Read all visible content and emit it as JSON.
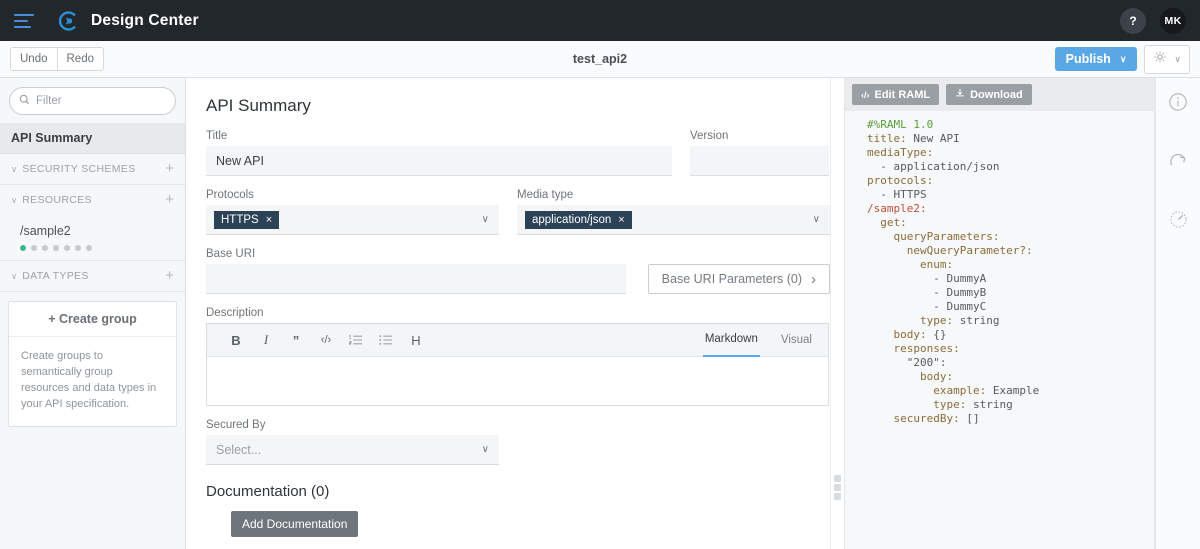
{
  "topbar": {
    "menu_icon": "hamburger-icon",
    "logo_icon": "mulesoft-logo-icon",
    "app_title": "Design Center",
    "help_label": "?",
    "avatar_initials": "MK"
  },
  "subbar": {
    "undo_label": "Undo",
    "redo_label": "Redo",
    "document_title": "test_api2",
    "publish_label": "Publish",
    "publish_color": "#5aa7e6",
    "publish_caret": "∨",
    "settings_icon": "gear-icon",
    "settings_caret": "∨"
  },
  "sidebar": {
    "filter_placeholder": "Filter",
    "filter_value": "",
    "search_icon": "search-icon",
    "active_item": "API Summary",
    "sections": [
      {
        "label": "SECURITY SCHEMES",
        "caret": "∨",
        "add": "+"
      },
      {
        "label": "RESOURCES",
        "caret": "∨",
        "add": "+"
      },
      {
        "label": "DATA TYPES",
        "caret": "∨",
        "add": "+"
      }
    ],
    "resource": {
      "name": "/sample2",
      "dots_total": 7,
      "dots_active": 1,
      "active_color": "#3fb58b",
      "inactive_color": "#c6cbcf"
    },
    "create_group": {
      "button_label": "+  Create group",
      "description": "Create groups to semantically group resources and data types in your API specification."
    }
  },
  "main": {
    "heading": "API Summary",
    "title": {
      "label": "Title",
      "value": "New API"
    },
    "version": {
      "label": "Version",
      "value": ""
    },
    "protocols": {
      "label": "Protocols",
      "chips": [
        "HTTPS"
      ],
      "caret": "∨"
    },
    "media_type": {
      "label": "Media type",
      "chips": [
        "application/json"
      ],
      "caret": "∨"
    },
    "base_uri": {
      "label": "Base URI",
      "value": "",
      "params_label": "Base URI Parameters (0)",
      "params_caret": "›"
    },
    "description": {
      "label": "Description",
      "value": "",
      "toolbar": [
        {
          "name": "bold-icon",
          "glyph": "B"
        },
        {
          "name": "italic-icon",
          "glyph": "I"
        },
        {
          "name": "quote-icon",
          "glyph": "”"
        },
        {
          "name": "code-icon",
          "glyph": "‹/›"
        },
        {
          "name": "ordered-list-icon",
          "glyph": "☰"
        },
        {
          "name": "bullet-list-icon",
          "glyph": "☰"
        },
        {
          "name": "heading-icon",
          "glyph": "H"
        }
      ],
      "tabs": [
        {
          "label": "Markdown",
          "active": true
        },
        {
          "label": "Visual",
          "active": false
        }
      ]
    },
    "secured_by": {
      "label": "Secured By",
      "placeholder": "Select...",
      "caret": "∨"
    },
    "documentation": {
      "heading": "Documentation (0)",
      "add_label": "Add Documentation"
    }
  },
  "raml": {
    "edit_label": "Edit RAML",
    "edit_icon": "code-icon",
    "download_label": "Download",
    "download_icon": "download-icon",
    "lines": [
      {
        "indent": 0,
        "text": "#%RAML 1.0",
        "cls": "c-com"
      },
      {
        "indent": 0,
        "key": "title:",
        "val": " New API"
      },
      {
        "indent": 0,
        "key": "mediaType:",
        "val": ""
      },
      {
        "indent": 1,
        "text": "- application/json",
        "cls": "c-val"
      },
      {
        "indent": 0,
        "key": "protocols:",
        "val": ""
      },
      {
        "indent": 1,
        "text": "- HTTPS",
        "cls": "c-val"
      },
      {
        "indent": 0,
        "text": "/sample2:",
        "cls": "c-res"
      },
      {
        "indent": 1,
        "key": "get:",
        "val": ""
      },
      {
        "indent": 2,
        "key": "queryParameters:",
        "val": ""
      },
      {
        "indent": 3,
        "key": "newQueryParameter?:",
        "val": ""
      },
      {
        "indent": 4,
        "key": "enum:",
        "val": ""
      },
      {
        "indent": 5,
        "text": "- DummyA",
        "cls": "c-val"
      },
      {
        "indent": 5,
        "text": "- DummyB",
        "cls": "c-val"
      },
      {
        "indent": 5,
        "text": "- DummyC",
        "cls": "c-val"
      },
      {
        "indent": 4,
        "key": "type:",
        "val": " string"
      },
      {
        "indent": 2,
        "key": "body:",
        "val": " {}"
      },
      {
        "indent": 2,
        "key": "responses:",
        "val": ""
      },
      {
        "indent": 3,
        "text": "\"200\":",
        "cls": "c-val"
      },
      {
        "indent": 4,
        "key": "body:",
        "val": ""
      },
      {
        "indent": 5,
        "key": "example:",
        "val": " Example"
      },
      {
        "indent": 5,
        "key": "type:",
        "val": " string"
      },
      {
        "indent": 2,
        "key": "securedBy:",
        "val": " []"
      }
    ]
  },
  "rail": {
    "icons": [
      {
        "name": "info-icon"
      },
      {
        "name": "redo-arrow-icon"
      },
      {
        "name": "mocking-service-icon"
      }
    ]
  }
}
